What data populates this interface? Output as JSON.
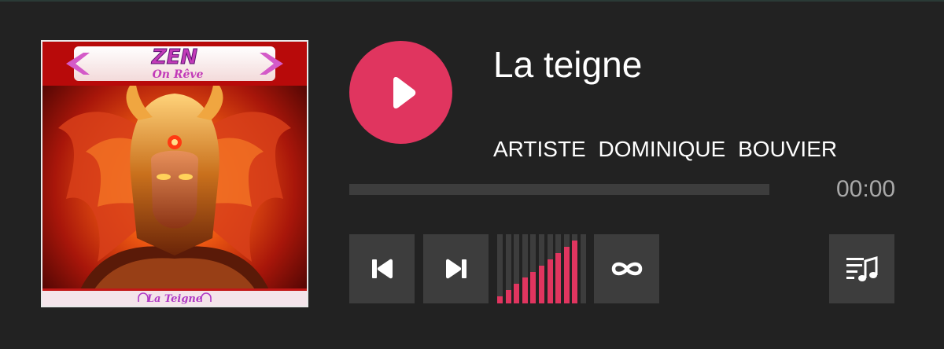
{
  "track": {
    "title": "La teigne",
    "artist": "ARTISTE  DOMINIQUE  BOUVIER",
    "time": "00:00",
    "progress_fraction": 0.0
  },
  "cover": {
    "brand_top": "ZEN",
    "brand_bottom": "On Rêve",
    "caption": "La Teigne"
  },
  "volume": {
    "level_fraction": 0.92,
    "bar_count": 11
  },
  "icons": {
    "play": "play-icon",
    "previous": "skip-previous-icon",
    "next": "skip-next-icon",
    "loop": "infinity-loop-icon",
    "playlist": "playlist-music-icon"
  },
  "colors": {
    "accent": "#e0355f",
    "background": "#222222",
    "control": "#3d3d3d",
    "text": "#ffffff",
    "time_text": "#a9a9a9"
  }
}
